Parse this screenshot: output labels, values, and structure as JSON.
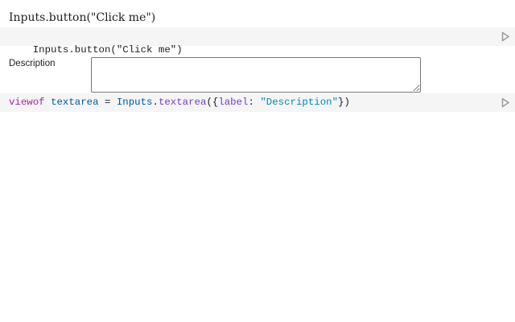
{
  "cells": [
    {
      "output_title": "Inputs.button(\"Click me\")",
      "code_tokens": [
        {
          "type": "punct",
          "text": "Inputs.button(\"Click me\")"
        }
      ]
    },
    {
      "form": {
        "label": "Description",
        "value": "",
        "placeholder": ""
      },
      "code_tokens": [
        {
          "type": "keyword",
          "text": "viewof"
        },
        {
          "type": "punct",
          "text": " "
        },
        {
          "type": "var",
          "text": "textarea"
        },
        {
          "type": "punct",
          "text": " = "
        },
        {
          "type": "var",
          "text": "Inputs"
        },
        {
          "type": "punct",
          "text": "."
        },
        {
          "type": "prop",
          "text": "textarea"
        },
        {
          "type": "punct",
          "text": "({"
        },
        {
          "type": "prop",
          "text": "label"
        },
        {
          "type": "punct",
          "text": ": "
        },
        {
          "type": "string",
          "text": "\"Description\""
        },
        {
          "type": "punct",
          "text": "})"
        }
      ]
    }
  ],
  "icons": {
    "run": "play-icon"
  },
  "colors": {
    "code_background": "#f5f5f5",
    "keyword": "#a626a4",
    "variable": "#005a9c",
    "property": "#6f42c1",
    "string": "#0089b8"
  }
}
